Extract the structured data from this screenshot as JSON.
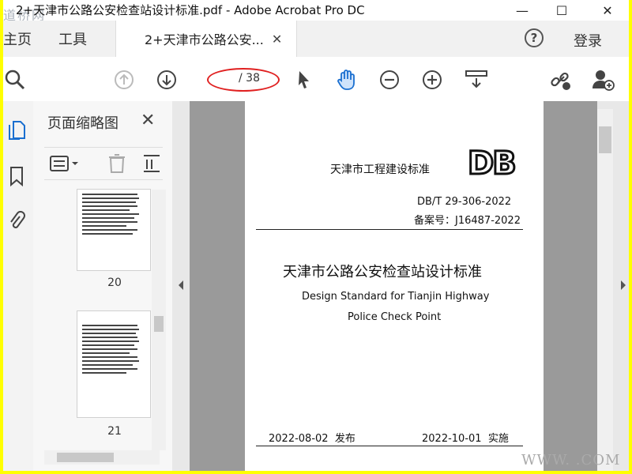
{
  "window": {
    "title": "2+天津市公路公安检查站设计标准.pdf - Adobe Acrobat Pro DC",
    "watermark_top": "道桥网",
    "watermark_bottom": "WWW.        .COM",
    "controls": [
      "—",
      "☐",
      "✕"
    ]
  },
  "tabs": {
    "home": "主页",
    "tools": "工具",
    "document": "2+天津市公路公安...",
    "close": "✕",
    "help": "?",
    "login": "登录"
  },
  "toolbar": {
    "current_page": "",
    "total_pages": "/ 38",
    "icons": [
      "search-icon",
      "page-up-icon",
      "page-down-icon",
      "select-cursor-icon",
      "hand-icon",
      "zoom-out-icon",
      "zoom-in-icon",
      "page-display-icon",
      "share-link-icon",
      "add-user-icon"
    ],
    "accent_color": "#1a6fd0",
    "highlight_color": "#e02020"
  },
  "sidebar": {
    "title": "页面缩略图",
    "close": "✕",
    "thumbnails": [
      {
        "page": "20"
      },
      {
        "page": "21"
      }
    ]
  },
  "document": {
    "org": "天津市工程建设标准",
    "logo": "DB",
    "code": "DB/T 29-306-2022",
    "record": "备案号：J16487-2022",
    "title_cn": "天津市公路公安检查站设计标准",
    "title_en_1": "Design Standard for Tianjin Highway",
    "title_en_2": "Police Check Point",
    "issue_date": "2022-08-02  发布",
    "effective_date": "2022-10-01  实施"
  }
}
